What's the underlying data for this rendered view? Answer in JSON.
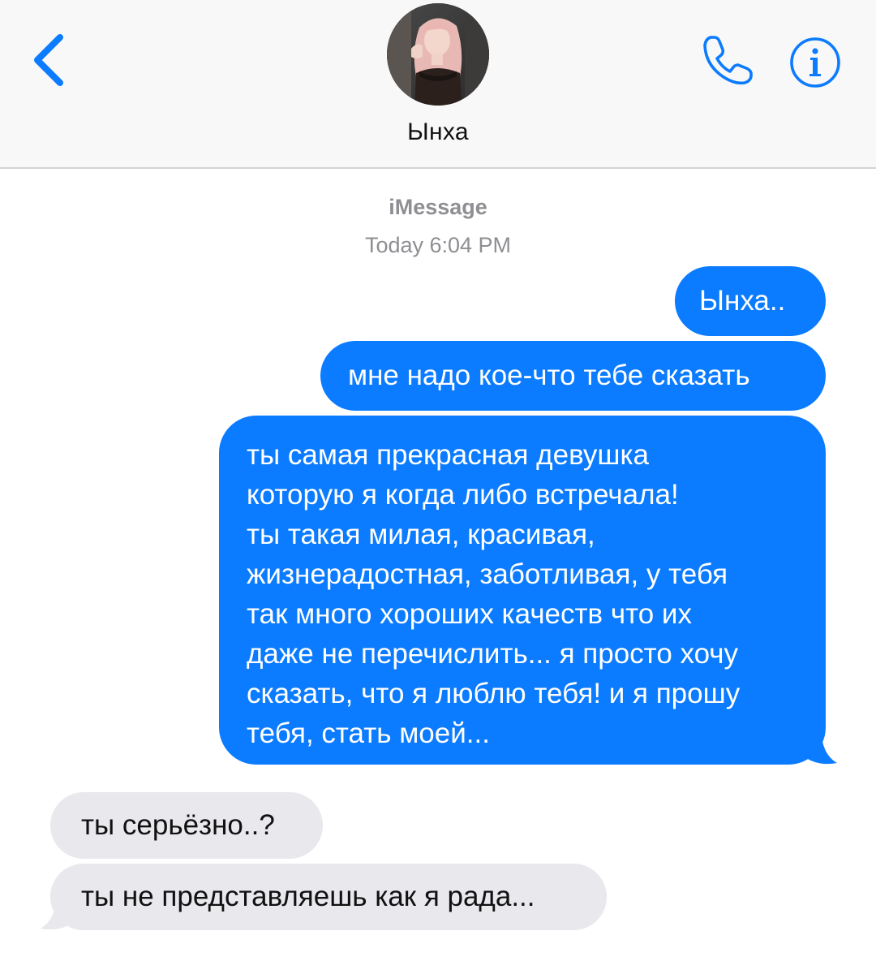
{
  "header": {
    "contact_name": "Ынха",
    "back_icon": "chevron-left-icon",
    "phone_icon": "phone-icon",
    "info_icon": "info-icon",
    "accent_color": "#0b7bff"
  },
  "conversation": {
    "service": "iMessage",
    "timestamp": "Today 6:04 PM",
    "messages": [
      {
        "direction": "outgoing",
        "text": "Ынха.."
      },
      {
        "direction": "outgoing",
        "text": "мне надо кое-что тебе сказать"
      },
      {
        "direction": "outgoing",
        "text": "ты самая прекрасная девушка\nкоторую я когда либо встречала!\nты такая милая, красивая,\nжизнерадостная, заботливая, у тебя\nтак много хороших качеств что их\nдаже не перечислить... я просто хочу\nсказать, что я люблю тебя! и я прошу\nтебя, стать моей..."
      },
      {
        "direction": "incoming",
        "text": "ты серьёзно..?"
      },
      {
        "direction": "incoming",
        "text": "ты не представляешь как я рада..."
      }
    ],
    "outgoing_color": "#0b7bff",
    "incoming_color": "#e8e8ed"
  }
}
